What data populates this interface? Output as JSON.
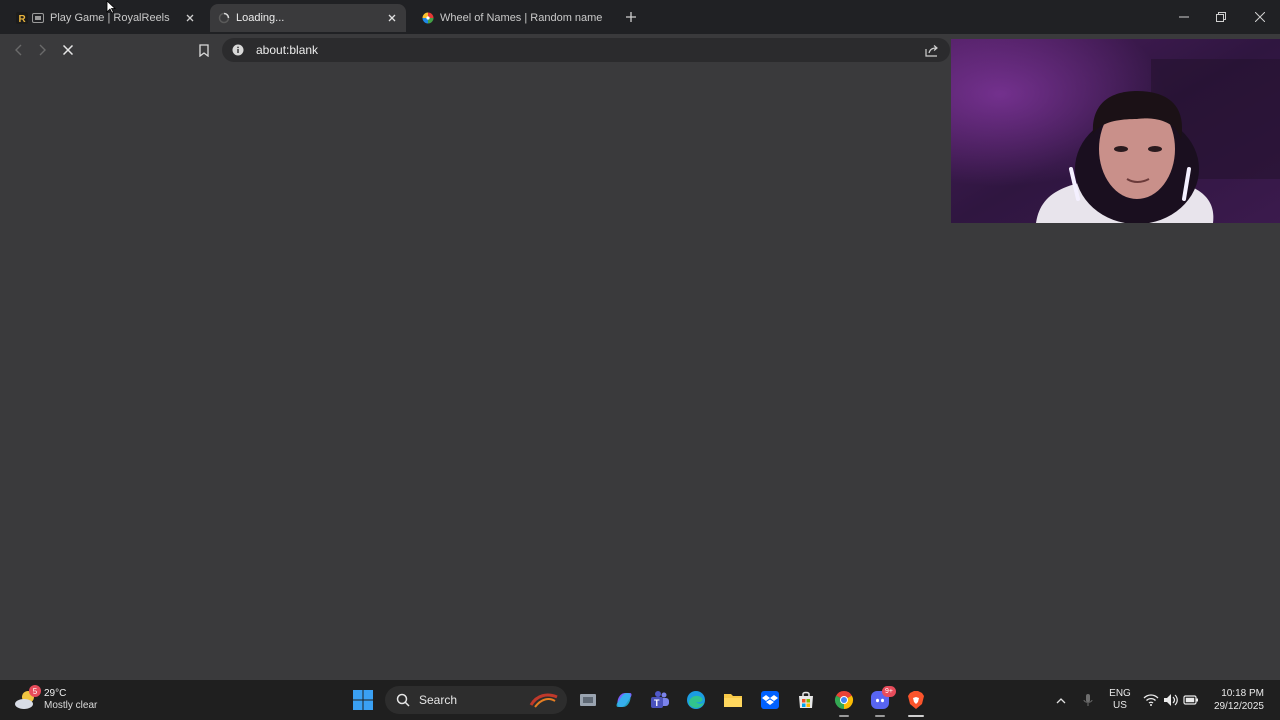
{
  "browser": {
    "tabs": [
      {
        "title": "Play Game | RoyalReels",
        "favicon": "royalreels-favicon",
        "active": false
      },
      {
        "title": "Loading...",
        "favicon": "loading-spinner-icon",
        "active": true
      },
      {
        "title": "Wheel of Names | Random name pic",
        "favicon": "wheel-of-names-favicon",
        "active": false
      }
    ],
    "address_bar": {
      "url": "about:blank"
    }
  },
  "taskbar": {
    "weather": {
      "badge": "5",
      "temperature": "29°C",
      "condition": "Mostly clear"
    },
    "search": {
      "label": "Search"
    },
    "discord_badge": "9+",
    "tray": {
      "language_line1": "ENG",
      "language_line2": "US"
    },
    "clock": {
      "time": "10:18 PM",
      "date": "29/12/2025"
    }
  },
  "colors": {
    "tab_strip": "#202124",
    "page_bg": "#3a3a3c",
    "taskbar": "#1f1f1f",
    "badge": "#e74c5b"
  }
}
